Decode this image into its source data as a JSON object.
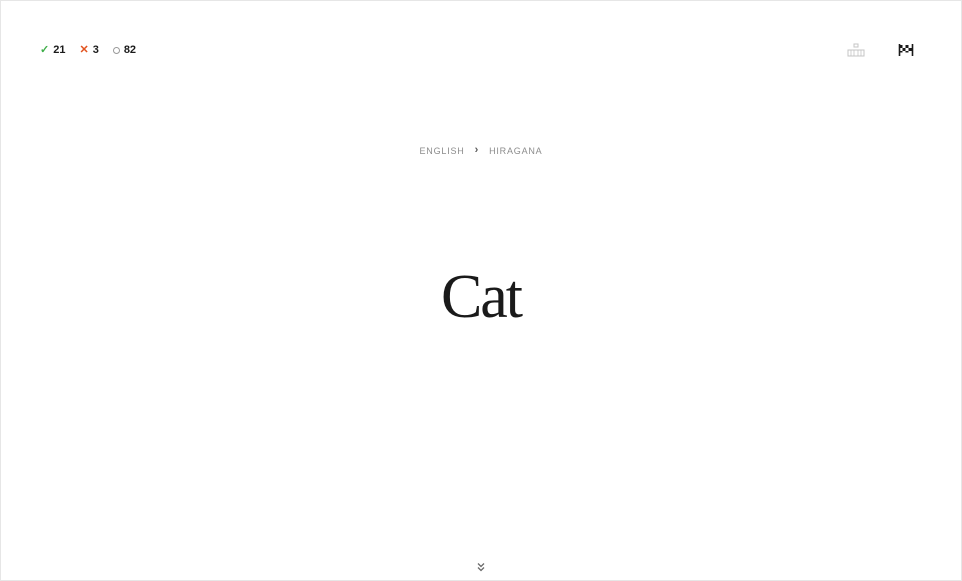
{
  "scores": {
    "correct": "21",
    "wrong": "3",
    "remaining": "82"
  },
  "icons": {
    "correct": "check-icon",
    "wrong": "cross-icon",
    "remaining": "ring-icon",
    "keyboard": "keyboard-icon",
    "flag": "flag-icon",
    "expand": "double-chevron-down-icon"
  },
  "direction": {
    "from": "ENGLISH",
    "to": "HIRAGANA"
  },
  "prompt": {
    "word": "Cat"
  },
  "colors": {
    "correct": "#3fae49",
    "wrong": "#e2531f",
    "remaining": "#9a9a9a"
  }
}
